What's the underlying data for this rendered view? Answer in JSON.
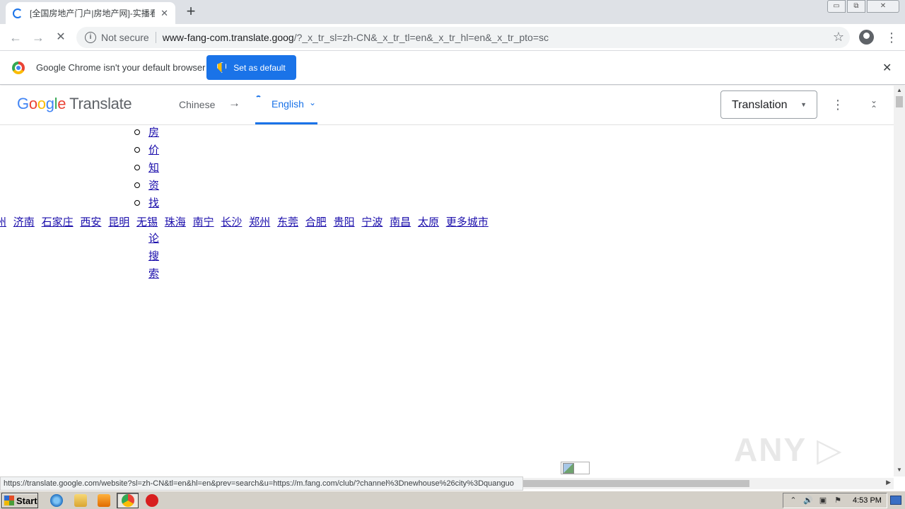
{
  "tab": {
    "title": "[全国房地产门户|房地产网]-实播看",
    "close": "✕"
  },
  "window_controls": {
    "minimize": "▭",
    "restore": "⧉",
    "close": "✕"
  },
  "toolbar": {
    "back": "←",
    "forward": "→",
    "reload": "✕",
    "security_label": "Not secure",
    "url_host": "www-fang-com.translate.goog",
    "url_path": "/?_x_tr_sl=zh-CN&_x_tr_tl=en&_x_tr_hl=en&_x_tr_pto=sc",
    "bookmark_star": "☆",
    "menu": "⋮"
  },
  "infobar": {
    "message": "Google Chrome isn't your default browser",
    "button_label": "Set as default",
    "close": "✕"
  },
  "translate_bar": {
    "logo_letters": [
      "G",
      "o",
      "o",
      "g",
      "l",
      "e"
    ],
    "logo_suffix": "Translate",
    "source_language": "Chinese",
    "arrow": "→",
    "target_language": "English",
    "target_chevron": "⌄",
    "mode": "Translation",
    "mode_caret": "▼",
    "more": "⋮",
    "collapse": "⌃⌄"
  },
  "content": {
    "vertical_links": [
      "房",
      "价",
      "知",
      "资",
      "找",
      "论",
      "搜",
      "索"
    ],
    "cities": [
      "州",
      "济南",
      "石家庄",
      "西安",
      "昆明",
      "无锡",
      "珠海",
      "南宁",
      "长沙",
      "郑州",
      "东莞",
      "合肥",
      "贵阳",
      "宁波",
      "南昌",
      "太原",
      "更多城市"
    ],
    "watermark": "ANY ▷ RUN"
  },
  "status_url": "https://translate.google.com/website?sl=zh-CN&tl=en&hl=en&prev=search&u=https://m.fang.com/club/?channel%3Dnewhouse%26city%3Dquanguo",
  "taskbar": {
    "start_label": "Start",
    "tray_icons": [
      "⌃",
      "🔊",
      "▣",
      "⚑"
    ],
    "clock": "4:53 PM"
  }
}
